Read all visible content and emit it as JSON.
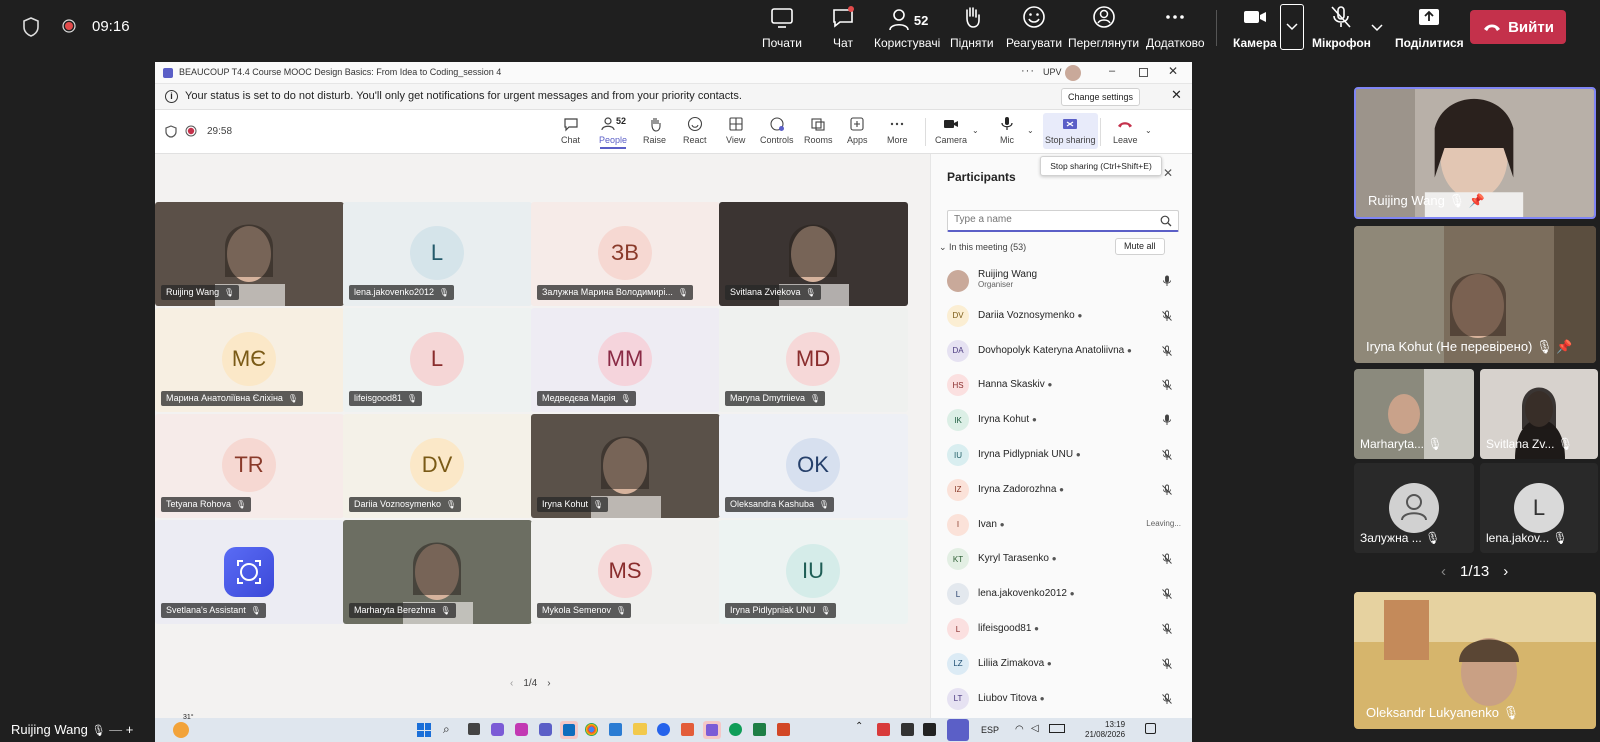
{
  "topbar": {
    "time": "09:16",
    "buttons": [
      {
        "label": "Почати",
        "icon": "share-screen-icon"
      },
      {
        "label": "Чат",
        "icon": "chat-icon"
      },
      {
        "label": "Користувачі",
        "icon": "people-icon",
        "count": "52"
      },
      {
        "label": "Підняти",
        "icon": "raise-hand-icon"
      },
      {
        "label": "Реагувати",
        "icon": "react-icon"
      },
      {
        "label": "Переглянути",
        "icon": "view-icon"
      },
      {
        "label": "Додатково",
        "icon": "more-icon"
      },
      {
        "label": "Камера",
        "icon": "camera-icon"
      },
      {
        "label": "Мікрофон",
        "icon": "mic-off-icon"
      },
      {
        "label": "Поділитися",
        "icon": "share-icon"
      }
    ],
    "leave": "Вийти"
  },
  "window": {
    "title": "BEAUCOUP T4.4 Course MOOC Design Basics: From Idea to Coding_session 4",
    "org": "UPV",
    "notice": "Your status is set to do not disturb. You'll only get notifications for urgent messages and from your priority contacts.",
    "change_settings": "Change settings",
    "timer": "29:58",
    "toolbar": [
      {
        "label": "Chat",
        "icon": "chat-icon"
      },
      {
        "label": "People",
        "icon": "people-icon",
        "count": "52"
      },
      {
        "label": "Raise",
        "icon": "raise-hand-icon"
      },
      {
        "label": "React",
        "icon": "react-icon"
      },
      {
        "label": "View",
        "icon": "view-icon"
      },
      {
        "label": "Controls",
        "icon": "controls-icon"
      },
      {
        "label": "Rooms",
        "icon": "rooms-icon"
      },
      {
        "label": "Apps",
        "icon": "apps-icon"
      },
      {
        "label": "More",
        "icon": "more-icon"
      },
      {
        "label": "Camera",
        "icon": "camera-icon"
      },
      {
        "label": "Mic",
        "icon": "mic-icon"
      },
      {
        "label": "Stop sharing",
        "icon": "stop-sharing-icon"
      },
      {
        "label": "Leave",
        "icon": "leave-icon"
      }
    ],
    "tooltip": "Stop sharing (Ctrl+Shift+E)",
    "page_indicator": "1/4"
  },
  "tiles": [
    {
      "name": "Ruijing Wang",
      "initials": "",
      "bg": "#5b5048",
      "video": true
    },
    {
      "name": "lena.jakovenko2012",
      "initials": "L",
      "bg": "#e9eef0",
      "av": "#d5e4ea",
      "fg": "#245a6b"
    },
    {
      "name": "Залужна Марина Володимирі...",
      "initials": "ЗВ",
      "bg": "#f6ebe8",
      "av": "#f6d8d2",
      "fg": "#8a3a2a"
    },
    {
      "name": "Svitlana Zviekova",
      "initials": "",
      "bg": "#3b3432",
      "video": true
    },
    {
      "name": "Марина Анатоліївна Єліхіна",
      "initials": "МЄ",
      "bg": "#f7efe2",
      "av": "#fbe8c8",
      "fg": "#7a5a16"
    },
    {
      "name": "lifeisgood81",
      "initials": "L",
      "bg": "#eef2f1",
      "av": "#f5d6d6",
      "fg": "#8a2d2d"
    },
    {
      "name": "Медведєва Марія",
      "initials": "ММ",
      "bg": "#eeecf3",
      "av": "#f5d4dc",
      "fg": "#8a2a45"
    },
    {
      "name": "Maryna Dmytriieva",
      "initials": "MD",
      "bg": "#eff1ef",
      "av": "#f6d8d8",
      "fg": "#8a2d2d"
    },
    {
      "name": "Tetyana Rohova",
      "initials": "TR",
      "bg": "#f6ebe9",
      "av": "#f6d8d2",
      "fg": "#8a3a2a"
    },
    {
      "name": "Dariia Voznosymenko",
      "initials": "DV",
      "bg": "#f4f1e8",
      "av": "#fbe8c8",
      "fg": "#7a5a16"
    },
    {
      "name": "Iryna Kohut",
      "initials": "",
      "bg": "#5a5149",
      "video": true
    },
    {
      "name": "Oleksandra Kashuba",
      "initials": "OK",
      "bg": "#eef0f5",
      "av": "#d7e0ef",
      "fg": "#26406b"
    },
    {
      "name": "Svetlana's Assistant",
      "initials": "",
      "bg": "#ececf3",
      "assistant": true
    },
    {
      "name": "Marharyta Berezhna",
      "initials": "",
      "bg": "#6c6e62",
      "video": true
    },
    {
      "name": "Mykola Semenov",
      "initials": "MS",
      "bg": "#f0f0ee",
      "av": "#f6d8d8",
      "fg": "#8a2d2d"
    },
    {
      "name": "Iryna Pidlypniak UNU",
      "initials": "IU",
      "bg": "#edf3f2",
      "av": "#d5ece9",
      "fg": "#1f5e56"
    }
  ],
  "participants": {
    "title": "Participants",
    "search_placeholder": "Type a name",
    "section": "In this meeting (53)",
    "mute_all": "Mute all",
    "list": [
      {
        "name": "Ruijing Wang",
        "sub": "Organiser",
        "initials": "",
        "av": "#c9a99a",
        "fg": "#fff",
        "mic": "on"
      },
      {
        "name": "Dariia Voznosymenko",
        "initials": "DV",
        "av": "#fbeed3",
        "fg": "#7a5a16",
        "mic": "off"
      },
      {
        "name": "Dovhopolyk Kateryna Anatoliivna",
        "initials": "DA",
        "av": "#e6e2f2",
        "fg": "#4b3a80",
        "mic": "off"
      },
      {
        "name": "Hanna Skaskiv",
        "initials": "HS",
        "av": "#fbe0e0",
        "fg": "#8a2d2d",
        "mic": "off"
      },
      {
        "name": "Iryna Kohut",
        "initials": "IK",
        "av": "#dcefe6",
        "fg": "#1f5e40",
        "mic": "on"
      },
      {
        "name": "Iryna Pidlypniak UNU",
        "initials": "IU",
        "av": "#d9eef0",
        "fg": "#1f5e66",
        "mic": "off"
      },
      {
        "name": "Iryna Zadorozhna",
        "initials": "IZ",
        "av": "#fbe2d9",
        "fg": "#8a3a2a",
        "mic": "off"
      },
      {
        "name": "Ivan",
        "initials": "I",
        "av": "#fbe2d9",
        "fg": "#8a3a2a",
        "mic": "leaving",
        "status": "Leaving..."
      },
      {
        "name": "Kyryl Tarasenko",
        "initials": "KT",
        "av": "#e3efe4",
        "fg": "#2d5e33",
        "mic": "off"
      },
      {
        "name": "lena.jakovenko2012",
        "initials": "L",
        "av": "#e3e8ee",
        "fg": "#26406b",
        "mic": "off"
      },
      {
        "name": "lifeisgood81",
        "initials": "L",
        "av": "#fbe0e0",
        "fg": "#8a2d2d",
        "mic": "off"
      },
      {
        "name": "Liliia Zimakova",
        "initials": "LZ",
        "av": "#dcebf5",
        "fg": "#1f4f73",
        "mic": "off"
      },
      {
        "name": "Liubov Titova",
        "initials": "LT",
        "av": "#e6e2f2",
        "fg": "#4b3a80",
        "mic": "off"
      }
    ]
  },
  "taskbar": {
    "temp": "31°",
    "lang": "ESP",
    "time": "13:19",
    "date": "21/08/2026"
  },
  "rail": {
    "tiles": [
      {
        "name": "Ruijing Wang"
      },
      {
        "name": "Iryna Kohut (Не перевірено)"
      },
      {
        "name": "Marharyta..."
      },
      {
        "name": "Svitlana Zv..."
      },
      {
        "name": "Залужна ..."
      },
      {
        "name": "lena.jakov...",
        "initials": "L"
      },
      {
        "name": "Oleksandr Lukyanenko"
      }
    ],
    "pager": "1/13"
  },
  "self_label": "Ruijing Wang"
}
